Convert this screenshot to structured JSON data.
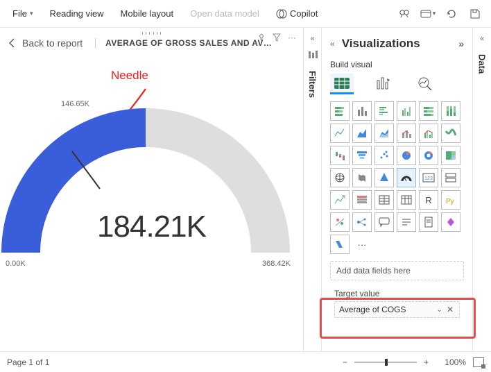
{
  "toolbar": {
    "file": "File",
    "reading": "Reading view",
    "mobile": "Mobile layout",
    "open_model": "Open data model",
    "copilot": "Copilot"
  },
  "header": {
    "back": "Back to report",
    "title": "AVERAGE OF GROSS SALES AND AVERAG…"
  },
  "annotation": {
    "needle": "Needle"
  },
  "chart_data": {
    "type": "gauge",
    "value": 184.21,
    "value_label": "184.21K",
    "min": 0.0,
    "min_label": "0.00K",
    "max": 368.42,
    "max_label": "368.42K",
    "needle": 146.65,
    "needle_label": "146.65K",
    "unit": "K"
  },
  "filters": {
    "label": "Filters"
  },
  "viz": {
    "title": "Visualizations",
    "subtitle": "Build visual",
    "add_fields": "Add data fields here",
    "target_label": "Target value",
    "target_value": "Average of COGS",
    "more": "···"
  },
  "data": {
    "label": "Data"
  },
  "status": {
    "page": "Page 1 of 1",
    "zoom": "100%"
  }
}
